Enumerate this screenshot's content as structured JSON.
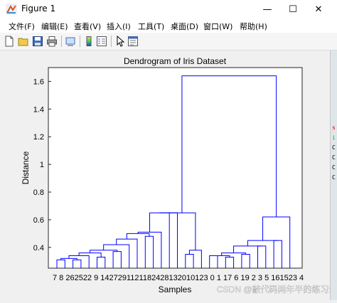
{
  "window": {
    "title": "Figure 1",
    "controls": {
      "minimize": "—",
      "maximize": "☐",
      "close": "✕"
    }
  },
  "menu": [
    {
      "label": "文件(F)"
    },
    {
      "label": "编辑(E)"
    },
    {
      "label": "查看(V)"
    },
    {
      "label": "插入(I)"
    },
    {
      "label": "工具(T)"
    },
    {
      "label": "桌面(D)"
    },
    {
      "label": "窗口(W)"
    },
    {
      "label": "帮助(H)"
    }
  ],
  "toolbar": [
    "new-figure-icon",
    "open-file-icon",
    "save-icon",
    "print-icon",
    "print-preview-icon",
    "colorbar-icon",
    "legend-icon",
    "pointer-icon",
    "property-editor-icon"
  ],
  "chart_data": {
    "type": "dendrogram",
    "title": "Dendrogram of Iris Dataset",
    "xlabel": "Samples",
    "ylabel": "Distance",
    "ylim": [
      0.25,
      1.7
    ],
    "yticks": [
      "0.4",
      "0.6",
      "0.8",
      "1",
      "1.2",
      "1.4",
      "1.6"
    ],
    "leaf_labels": [
      "7",
      "8",
      "26",
      "25",
      "22",
      "9",
      "14",
      "27",
      "29",
      "11",
      "21",
      "18",
      "24",
      "28",
      "13",
      "20",
      "10",
      "12",
      "30",
      "1",
      "17",
      "6",
      "19",
      "2",
      "3",
      "5",
      "16",
      "15",
      "23",
      "4"
    ],
    "leaves_order_display": "7 8 262522 9 1427291121182428132010123 0 1 17 6 19 2 3 5 161523 4",
    "merge_heights": [
      0.31,
      0.31,
      0.32,
      0.34,
      0.33,
      0.36,
      0.37,
      0.38,
      0.42,
      0.46,
      0.48,
      0.5,
      0.51,
      0.65,
      0.35,
      0.38,
      0.34,
      0.33,
      0.34,
      0.35,
      0.36,
      0.41,
      0.45,
      0.62,
      1.64
    ],
    "line_color": "#0000ff",
    "background": "#ffffff"
  },
  "watermark": "CSDN @敲代码两年半的练习生",
  "right_strip_marks": [
    "s",
    "i",
    "C",
    "C",
    "C",
    "C"
  ]
}
